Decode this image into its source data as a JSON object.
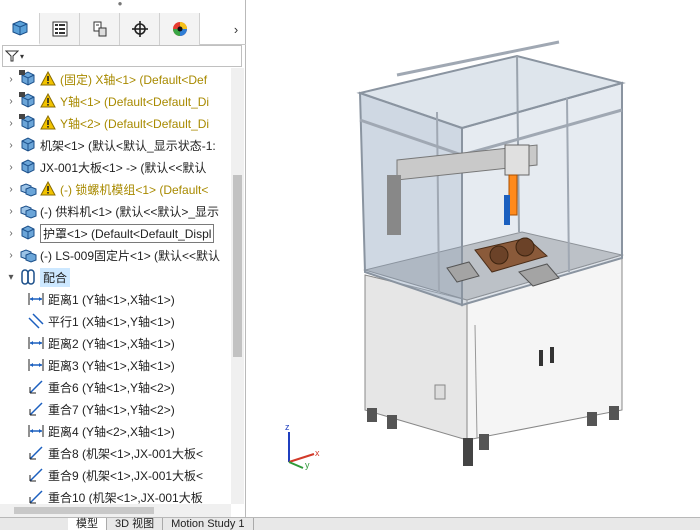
{
  "panel": {
    "tabs": [
      {
        "icon": "feature-manager-icon"
      },
      {
        "icon": "property-manager-icon"
      },
      {
        "icon": "configuration-manager-icon"
      },
      {
        "icon": "dimxpert-icon"
      },
      {
        "icon": "display-manager-icon"
      }
    ],
    "more_arrow": "›",
    "filter_caret": "▾"
  },
  "tree": {
    "items": [
      {
        "label": "(固定) X轴<1> (Default<Def",
        "icon": "part-warning",
        "warn": true,
        "color": "yellow"
      },
      {
        "label": "Y轴<1> (Default<Default_Di",
        "icon": "part-warning",
        "warn": true,
        "color": "yellow"
      },
      {
        "label": "Y轴<2> (Default<Default_Di",
        "icon": "part-warning",
        "warn": true,
        "color": "yellow"
      },
      {
        "label": "机架<1> (默认<默认_显示状态-1:",
        "icon": "part",
        "warn": false,
        "color": "normal"
      },
      {
        "label": "JX-001大板<1> -> (默认<<默认",
        "icon": "part",
        "warn": false,
        "color": "normal"
      },
      {
        "label": "(-) 锁螺机模组<1> (Default<",
        "icon": "assembly",
        "warn": true,
        "color": "yellow"
      },
      {
        "label": "(-) 供料机<1> (默认<<默认>_显示",
        "icon": "assembly",
        "warn": false,
        "color": "normal"
      },
      {
        "label": "护罩<1> (Default<Default_Displ",
        "icon": "part",
        "warn": false,
        "color": "normal",
        "selected": true
      },
      {
        "label": "(-) LS-009固定片<1> (默认<<默认",
        "icon": "assembly",
        "warn": false,
        "color": "normal"
      },
      {
        "label": "配合",
        "icon": "mates",
        "warn": false,
        "color": "normal",
        "mates": true
      }
    ],
    "mates": [
      {
        "label": "距离1 (Y轴<1>,X轴<1>)",
        "icon": "distance"
      },
      {
        "label": "平行1 (X轴<1>,Y轴<1>)",
        "icon": "parallel"
      },
      {
        "label": "距离2 (Y轴<1>,X轴<1>)",
        "icon": "distance"
      },
      {
        "label": "距离3 (Y轴<1>,X轴<1>)",
        "icon": "distance"
      },
      {
        "label": "重合6 (Y轴<1>,Y轴<2>)",
        "icon": "coincident"
      },
      {
        "label": "重合7 (Y轴<1>,Y轴<2>)",
        "icon": "coincident"
      },
      {
        "label": "距离4 (Y轴<2>,X轴<1>)",
        "icon": "distance"
      },
      {
        "label": "重合8 (机架<1>,JX-001大板<",
        "icon": "coincident"
      },
      {
        "label": "重合9 (机架<1>,JX-001大板<",
        "icon": "coincident"
      },
      {
        "label": "重合10 (机架<1>,JX-001大板",
        "icon": "coincident"
      }
    ]
  },
  "bottom_tabs": [
    {
      "label": "模型",
      "active": true
    },
    {
      "label": "3D 视图",
      "active": false
    },
    {
      "label": "Motion Study 1",
      "active": false
    }
  ],
  "triad": {
    "x": "x",
    "y": "y",
    "z": "z"
  },
  "colors": {
    "warning": "#f2c300",
    "selection": "#cde8ff",
    "accent_blue": "#1b5fbf",
    "frame": "#c8ccd4",
    "cabinet": "#f4f4f4"
  }
}
